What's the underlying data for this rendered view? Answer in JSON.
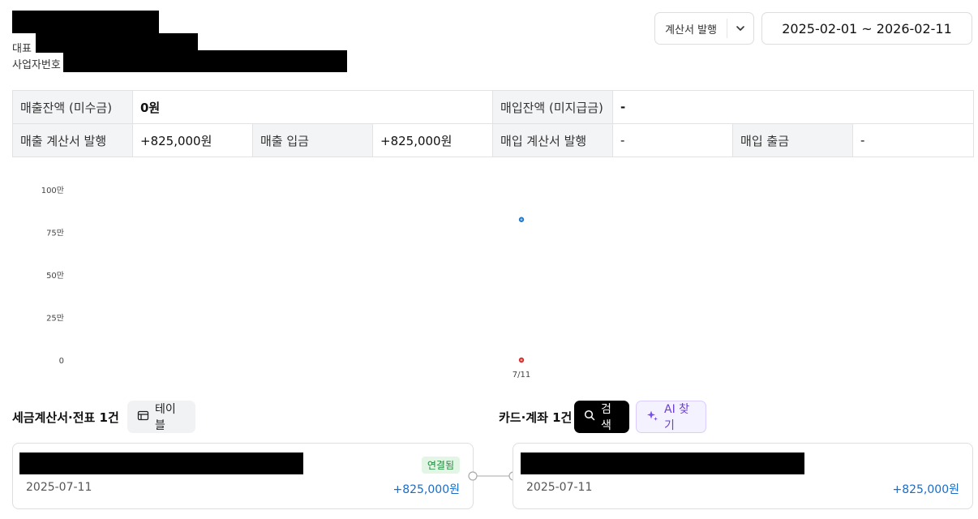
{
  "header": {
    "rep_label": "대표",
    "biz_no_label": "사업자번호"
  },
  "controls": {
    "issue_label": "계산서 발행",
    "date_range": "2025-02-01 ~ 2026-02-11"
  },
  "summary": {
    "sales_balance_label": "매출잔액 (미수금)",
    "sales_balance_value": "0원",
    "purchase_balance_label": "매입잔액 (미지급금)",
    "purchase_balance_value": "-",
    "sales_invoice_label": "매출 계산서 발행",
    "sales_invoice_value": "+825,000원",
    "sales_deposit_label": "매출 입금",
    "sales_deposit_value": "+825,000원",
    "purchase_invoice_label": "매입 계산서 발행",
    "purchase_invoice_value": "-",
    "purchase_withdraw_label": "매입 출금",
    "purchase_withdraw_value": "-"
  },
  "chart_data": {
    "type": "scatter",
    "y_ticks": [
      "0",
      "25만",
      "50만",
      "75만",
      "100만"
    ],
    "x_ticks": [
      "7/11"
    ],
    "ylim": [
      0,
      1000000
    ],
    "series": [
      {
        "color": "#1f78c8",
        "points": [
          {
            "x": "7/11",
            "y": 825000
          }
        ]
      },
      {
        "color": "#d62c2c",
        "points": [
          {
            "x": "7/11",
            "y": 0
          }
        ]
      }
    ]
  },
  "left_section": {
    "title": "세금계산서·전표 1건",
    "table_button": "테이블",
    "card": {
      "badge": "연결됨",
      "date": "2025-07-11",
      "amount": "+825,000원"
    }
  },
  "right_section": {
    "title": "카드·계좌 1건",
    "search_button": "검색",
    "ai_button": "AI 찾기",
    "card": {
      "date": "2025-07-11",
      "amount": "+825,000원"
    }
  },
  "colors": {
    "accent_blue": "#1a6cc7",
    "badge_green": "#1d8a3a",
    "ai_purple": "#6b3ed8"
  }
}
